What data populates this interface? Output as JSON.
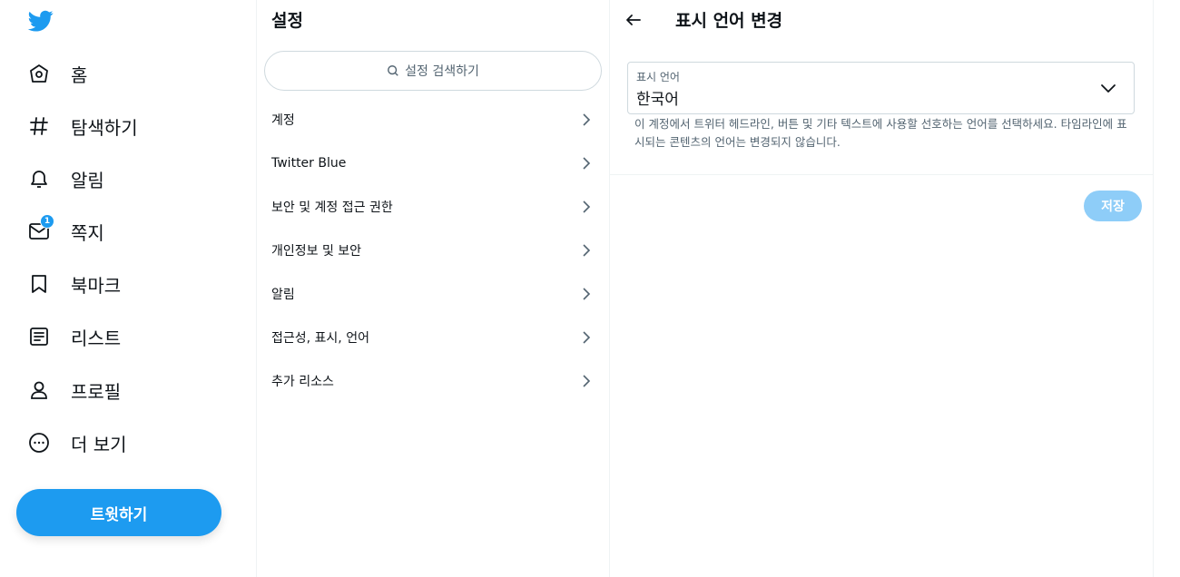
{
  "nav": {
    "items": [
      {
        "label": "홈",
        "icon": "home-icon"
      },
      {
        "label": "탐색하기",
        "icon": "hashtag-icon"
      },
      {
        "label": "알림",
        "icon": "bell-icon"
      },
      {
        "label": "쪽지",
        "icon": "mail-icon",
        "badge": "1"
      },
      {
        "label": "북마크",
        "icon": "bookmark-icon"
      },
      {
        "label": "리스트",
        "icon": "list-icon"
      },
      {
        "label": "프로필",
        "icon": "profile-icon"
      },
      {
        "label": "더 보기",
        "icon": "more-icon"
      }
    ],
    "tweet_button": "트윗하기"
  },
  "settings": {
    "title": "설정",
    "search_placeholder": "설정 검색하기",
    "items": [
      {
        "label": "계정"
      },
      {
        "label": "Twitter Blue"
      },
      {
        "label": "보안 및 계정 접근 권한"
      },
      {
        "label": "개인정보 및 보안"
      },
      {
        "label": "알림"
      },
      {
        "label": "접근성, 표시, 언어"
      },
      {
        "label": "추가 리소스"
      }
    ]
  },
  "detail": {
    "title": "표시 언어 변경",
    "field_label": "표시 언어",
    "field_value": "한국어",
    "help_text": "이 계정에서 트위터 헤드라인, 버튼 및 기타 텍스트에 사용할 선호하는 언어를 선택하세요. 타임라인에 표시되는 콘텐츠의 언어는 변경되지 않습니다.",
    "save_label": "저장"
  },
  "colors": {
    "accent": "#1d9bf0",
    "accent_disabled": "#8ecdf8",
    "text": "#0f1419",
    "muted": "#536471"
  }
}
